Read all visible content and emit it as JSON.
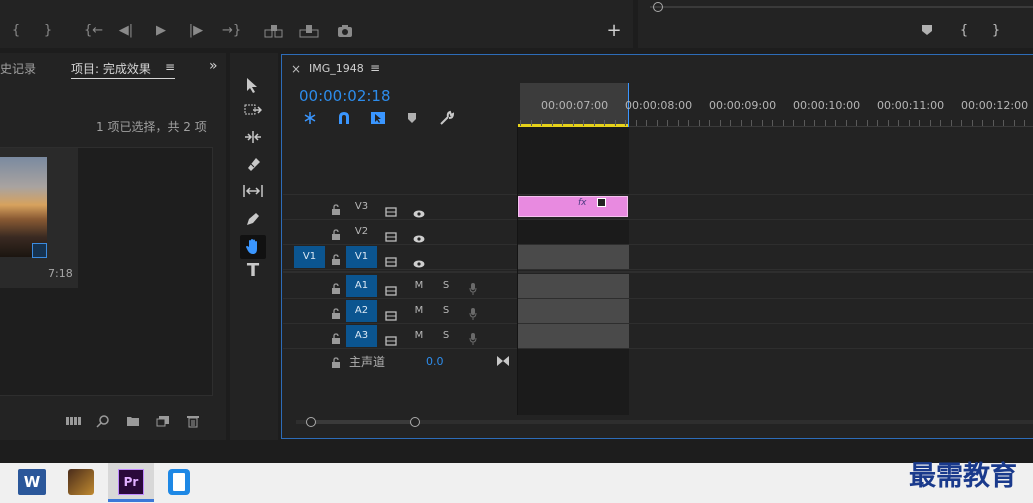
{
  "source_monitor": {
    "transport_buttons": [
      "mark-in-icon",
      "mark-out-icon",
      "go-to-in-icon",
      "step-back-icon",
      "play-icon",
      "step-forward-icon",
      "go-to-out-icon",
      "insert-icon",
      "overwrite-icon",
      "export-frame-icon"
    ],
    "add_button": "+"
  },
  "program_monitor": {
    "buttons": [
      "add-marker-icon",
      "mark-in-icon",
      "mark-out-icon"
    ]
  },
  "project_panel": {
    "tab_history_partial": "史记录",
    "tab_project": "项目: 完成效果",
    "menu_glyph": "≡",
    "overflow_glyph": "»",
    "selection_status": "1 项已选择，共 2 项",
    "clip_duration": "7:18"
  },
  "tools": [
    "selection-tool",
    "track-select-tool",
    "ripple-edit-tool",
    "razor-tool",
    "slip-tool",
    "pen-tool",
    "hand-tool",
    "type-tool"
  ],
  "timeline": {
    "close_glyph": "×",
    "sequence_name": "IMG_1948",
    "menu_glyph": "≡",
    "timecode": "00:00:02:18",
    "ruler_labels": [
      "00:00:07:00",
      "00:00:08:00",
      "00:00:09:00",
      "00:00:10:00",
      "00:00:11:00",
      "00:00:12:00"
    ],
    "video_tracks": [
      {
        "name": "V3",
        "source": ""
      },
      {
        "name": "V2",
        "source": ""
      },
      {
        "name": "V1",
        "source": "V1"
      }
    ],
    "audio_tracks": [
      {
        "name": "A1",
        "m": "M",
        "s": "S"
      },
      {
        "name": "A2",
        "m": "M",
        "s": "S"
      },
      {
        "name": "A3",
        "m": "M",
        "s": "S"
      }
    ],
    "master_label": "主声道",
    "master_value": "0.0",
    "clip_fx_badge": "fx"
  },
  "taskbar": {
    "apps": [
      "word-app-icon",
      "media-app-icon",
      "premiere-app-icon",
      "phone-app-icon"
    ],
    "premiere_label": "Pr",
    "watermark": "最需教育"
  },
  "colors": {
    "accent_blue": "#2d8ceb",
    "track_blue": "#0b5590",
    "clip_pink": "#e88ae0",
    "playhead_yellow": "#e6d21a"
  }
}
